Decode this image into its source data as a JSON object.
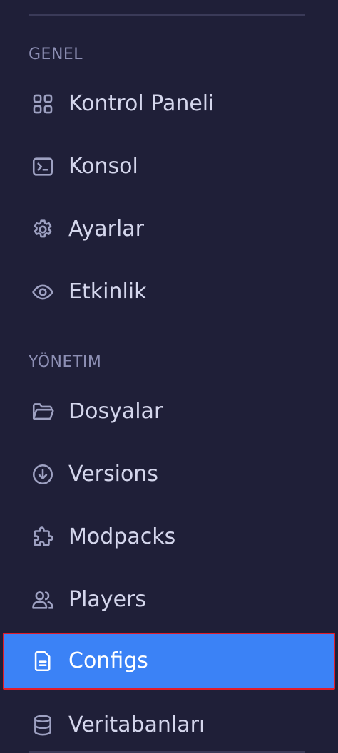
{
  "sections": {
    "general": {
      "title": "GENEL"
    },
    "management": {
      "title": "YÖNETIM"
    }
  },
  "nav": {
    "dashboard": {
      "label": "Kontrol Paneli",
      "icon": "grid-icon"
    },
    "console": {
      "label": "Konsol",
      "icon": "terminal-icon"
    },
    "settings": {
      "label": "Ayarlar",
      "icon": "gear-icon"
    },
    "activity": {
      "label": "Etkinlik",
      "icon": "eye-icon"
    },
    "files": {
      "label": "Dosyalar",
      "icon": "folder-icon"
    },
    "versions": {
      "label": "Versions",
      "icon": "download-circle-icon"
    },
    "modpacks": {
      "label": "Modpacks",
      "icon": "puzzle-icon"
    },
    "players": {
      "label": "Players",
      "icon": "users-icon"
    },
    "configs": {
      "label": "Configs",
      "icon": "document-icon",
      "active": true
    },
    "databases": {
      "label": "Veritabanları",
      "icon": "database-icon"
    }
  },
  "colors": {
    "background": "#1f1f38",
    "active_bg": "#3b82f6",
    "active_border": "#e11d2a",
    "section_label": "#8d8fb4",
    "item_text": "#d4d6ec",
    "icon": "#9ea1c2"
  }
}
